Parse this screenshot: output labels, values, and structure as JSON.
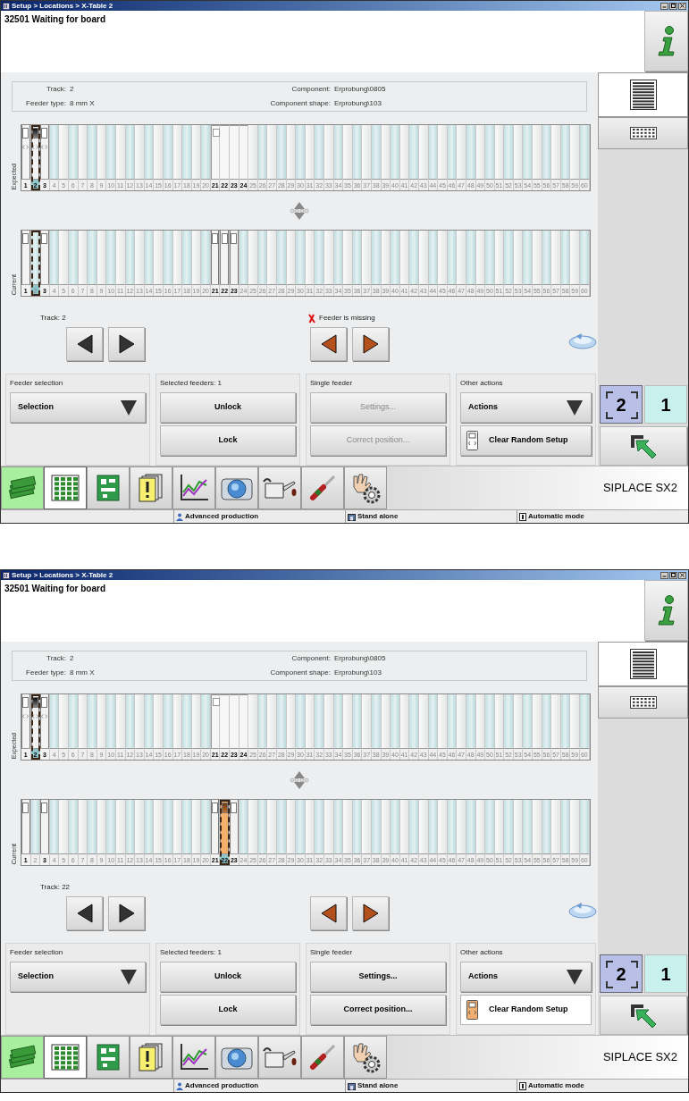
{
  "screens": [
    {
      "title": "Setup > Locations > X-Table 2",
      "message": "32501 Waiting for board",
      "info": [
        {
          "label": "Track:",
          "value": "2"
        },
        {
          "label": "Component:",
          "value": "Erprobung\\0805"
        },
        {
          "label": "Feeder type:",
          "value": "8 mm X"
        },
        {
          "label": "Component shape:",
          "value": "Erprobung\\103"
        }
      ],
      "view_tabs": [
        {
          "kind": "list",
          "selected": true
        },
        {
          "kind": "grid",
          "selected": false
        }
      ],
      "strips": [
        {
          "label": "Expected",
          "slots": [
            {
              "label": "1",
              "kind": "feeder",
              "selected": false
            },
            {
              "label": "2",
              "kind": "feeder",
              "selected": true
            },
            {
              "label": "3",
              "kind": "feeder",
              "selected": false
            },
            {
              "label": "4",
              "kind": "empty",
              "selected": false
            },
            {
              "label": "5",
              "kind": "empty",
              "selected": false
            },
            {
              "label": "6",
              "kind": "empty",
              "selected": false
            },
            {
              "label": "7",
              "kind": "empty",
              "selected": false
            },
            {
              "label": "8",
              "kind": "empty",
              "selected": false
            },
            {
              "label": "9",
              "kind": "empty",
              "selected": false
            },
            {
              "label": "10",
              "kind": "empty",
              "selected": false
            },
            {
              "label": "11",
              "kind": "empty",
              "selected": false
            },
            {
              "label": "12",
              "kind": "empty",
              "selected": false
            },
            {
              "label": "13",
              "kind": "empty",
              "selected": false
            },
            {
              "label": "14",
              "kind": "empty",
              "selected": false
            },
            {
              "label": "15",
              "kind": "empty",
              "selected": false
            },
            {
              "label": "16",
              "kind": "empty",
              "selected": false
            },
            {
              "label": "17",
              "kind": "empty",
              "selected": false
            },
            {
              "label": "18",
              "kind": "empty",
              "selected": false
            },
            {
              "label": "19",
              "kind": "empty",
              "selected": false
            },
            {
              "label": "20",
              "kind": "empty",
              "selected": false
            },
            {
              "label": "21",
              "kind": "wide",
              "selected": false
            },
            {
              "label": "22",
              "kind": "wide",
              "selected": false
            },
            {
              "label": "23",
              "kind": "wide",
              "selected": false
            },
            {
              "label": "24",
              "kind": "wide",
              "selected": false
            },
            {
              "label": "25",
              "kind": "empty",
              "selected": false
            },
            {
              "label": "26",
              "kind": "empty",
              "selected": false
            },
            {
              "label": "27",
              "kind": "empty",
              "selected": false
            },
            {
              "label": "28",
              "kind": "empty",
              "selected": false
            },
            {
              "label": "29",
              "kind": "empty",
              "selected": false
            },
            {
              "label": "30",
              "kind": "empty",
              "selected": false
            },
            {
              "label": "31",
              "kind": "empty",
              "selected": false
            },
            {
              "label": "32",
              "kind": "empty",
              "selected": false
            },
            {
              "label": "33",
              "kind": "empty",
              "selected": false
            },
            {
              "label": "34",
              "kind": "empty",
              "selected": false
            },
            {
              "label": "35",
              "kind": "empty",
              "selected": false
            },
            {
              "label": "36",
              "kind": "empty",
              "selected": false
            },
            {
              "label": "37",
              "kind": "empty",
              "selected": false
            },
            {
              "label": "38",
              "kind": "empty",
              "selected": false
            },
            {
              "label": "39",
              "kind": "empty",
              "selected": false
            },
            {
              "label": "40",
              "kind": "empty",
              "selected": false
            },
            {
              "label": "41",
              "kind": "empty",
              "selected": false
            },
            {
              "label": "42",
              "kind": "empty",
              "selected": false
            },
            {
              "label": "43",
              "kind": "empty",
              "selected": false
            },
            {
              "label": "44",
              "kind": "empty",
              "selected": false
            },
            {
              "label": "45",
              "kind": "empty",
              "selected": false
            },
            {
              "label": "46",
              "kind": "empty",
              "selected": false
            },
            {
              "label": "47",
              "kind": "empty",
              "selected": false
            },
            {
              "label": "48",
              "kind": "empty",
              "selected": false
            },
            {
              "label": "49",
              "kind": "empty",
              "selected": false
            },
            {
              "label": "50",
              "kind": "empty",
              "selected": false
            },
            {
              "label": "51",
              "kind": "empty",
              "selected": false
            },
            {
              "label": "52",
              "kind": "empty",
              "selected": false
            },
            {
              "label": "53",
              "kind": "empty",
              "selected": false
            },
            {
              "label": "54",
              "kind": "empty",
              "selected": false
            },
            {
              "label": "55",
              "kind": "empty",
              "selected": false
            },
            {
              "label": "56",
              "kind": "empty",
              "selected": false
            },
            {
              "label": "57",
              "kind": "empty",
              "selected": false
            },
            {
              "label": "58",
              "kind": "empty",
              "selected": false
            },
            {
              "label": "59",
              "kind": "empty",
              "selected": false
            },
            {
              "label": "60",
              "kind": "empty",
              "selected": false
            }
          ]
        },
        {
          "label": "Current",
          "slots": [
            {
              "label": "1",
              "kind": "feeder",
              "selected": false
            },
            {
              "label": "2",
              "kind": "empty",
              "selected": true
            },
            {
              "label": "3",
              "kind": "feeder",
              "selected": false
            },
            {
              "label": "4",
              "kind": "empty",
              "selected": false
            },
            {
              "label": "5",
              "kind": "empty",
              "selected": false
            },
            {
              "label": "6",
              "kind": "empty",
              "selected": false
            },
            {
              "label": "7",
              "kind": "empty",
              "selected": false
            },
            {
              "label": "8",
              "kind": "empty",
              "selected": false
            },
            {
              "label": "9",
              "kind": "empty",
              "selected": false
            },
            {
              "label": "10",
              "kind": "empty",
              "selected": false
            },
            {
              "label": "11",
              "kind": "empty",
              "selected": false
            },
            {
              "label": "12",
              "kind": "empty",
              "selected": false
            },
            {
              "label": "13",
              "kind": "empty",
              "selected": false
            },
            {
              "label": "14",
              "kind": "empty",
              "selected": false
            },
            {
              "label": "15",
              "kind": "empty",
              "selected": false
            },
            {
              "label": "16",
              "kind": "empty",
              "selected": false
            },
            {
              "label": "17",
              "kind": "empty",
              "selected": false
            },
            {
              "label": "18",
              "kind": "empty",
              "selected": false
            },
            {
              "label": "19",
              "kind": "empty",
              "selected": false
            },
            {
              "label": "20",
              "kind": "empty",
              "selected": false
            },
            {
              "label": "21",
              "kind": "feeder",
              "selected": false
            },
            {
              "label": "22",
              "kind": "feeder",
              "selected": false
            },
            {
              "label": "23",
              "kind": "feeder",
              "selected": false
            },
            {
              "label": "24",
              "kind": "empty",
              "selected": false
            },
            {
              "label": "25",
              "kind": "empty",
              "selected": false
            },
            {
              "label": "26",
              "kind": "empty",
              "selected": false
            },
            {
              "label": "27",
              "kind": "empty",
              "selected": false
            },
            {
              "label": "28",
              "kind": "empty",
              "selected": false
            },
            {
              "label": "29",
              "kind": "empty",
              "selected": false
            },
            {
              "label": "30",
              "kind": "empty",
              "selected": false
            },
            {
              "label": "31",
              "kind": "empty",
              "selected": false
            },
            {
              "label": "32",
              "kind": "empty",
              "selected": false
            },
            {
              "label": "33",
              "kind": "empty",
              "selected": false
            },
            {
              "label": "34",
              "kind": "empty",
              "selected": false
            },
            {
              "label": "35",
              "kind": "empty",
              "selected": false
            },
            {
              "label": "36",
              "kind": "empty",
              "selected": false
            },
            {
              "label": "37",
              "kind": "empty",
              "selected": false
            },
            {
              "label": "38",
              "kind": "empty",
              "selected": false
            },
            {
              "label": "39",
              "kind": "empty",
              "selected": false
            },
            {
              "label": "40",
              "kind": "empty",
              "selected": false
            },
            {
              "label": "41",
              "kind": "empty",
              "selected": false
            },
            {
              "label": "42",
              "kind": "empty",
              "selected": false
            },
            {
              "label": "43",
              "kind": "empty",
              "selected": false
            },
            {
              "label": "44",
              "kind": "empty",
              "selected": false
            },
            {
              "label": "45",
              "kind": "empty",
              "selected": false
            },
            {
              "label": "46",
              "kind": "empty",
              "selected": false
            },
            {
              "label": "47",
              "kind": "empty",
              "selected": false
            },
            {
              "label": "48",
              "kind": "empty",
              "selected": false
            },
            {
              "label": "49",
              "kind": "empty",
              "selected": false
            },
            {
              "label": "50",
              "kind": "empty",
              "selected": false
            },
            {
              "label": "51",
              "kind": "empty",
              "selected": false
            },
            {
              "label": "52",
              "kind": "empty",
              "selected": false
            },
            {
              "label": "53",
              "kind": "empty",
              "selected": false
            },
            {
              "label": "54",
              "kind": "empty",
              "selected": false
            },
            {
              "label": "55",
              "kind": "empty",
              "selected": false
            },
            {
              "label": "56",
              "kind": "empty",
              "selected": false
            },
            {
              "label": "57",
              "kind": "empty",
              "selected": false
            },
            {
              "label": "58",
              "kind": "empty",
              "selected": false
            },
            {
              "label": "59",
              "kind": "empty",
              "selected": false
            },
            {
              "label": "60",
              "kind": "empty",
              "selected": false
            }
          ]
        }
      ],
      "track_label": "Track: 2",
      "feeder_status": {
        "text": "Feeder is missing",
        "kind": "error"
      },
      "panels": [
        {
          "title": "Feeder selection",
          "controls": [
            {
              "kind": "dropdown",
              "label": "Selection"
            }
          ]
        },
        {
          "title": "Selected feeders: 1",
          "controls": [
            {
              "kind": "button",
              "label": "Unlock",
              "disabled": false
            },
            {
              "kind": "button",
              "label": "Lock",
              "disabled": false
            }
          ]
        },
        {
          "title": "Single feeder",
          "controls": [
            {
              "kind": "button",
              "label": "Settings...",
              "disabled": true
            },
            {
              "kind": "button",
              "label": "Correct position...",
              "disabled": true
            }
          ]
        },
        {
          "title": "Other actions",
          "controls": [
            {
              "kind": "dropdown",
              "label": "Actions"
            },
            {
              "kind": "icon_button",
              "label": "Clear Random Setup",
              "highlighted": false
            }
          ]
        }
      ],
      "layer_buttons": [
        {
          "label": "2",
          "selected": true
        },
        {
          "label": "1",
          "selected": false
        }
      ],
      "tools": [
        {
          "kind": "banknotes",
          "active": true,
          "selected": false
        },
        {
          "kind": "grid",
          "active": false,
          "selected": true
        },
        {
          "kind": "board",
          "active": false,
          "selected": false
        },
        {
          "kind": "documents",
          "active": false,
          "selected": false
        },
        {
          "kind": "chart",
          "active": false,
          "selected": false
        },
        {
          "kind": "camera",
          "active": false,
          "selected": false
        },
        {
          "kind": "oilcan",
          "active": false,
          "selected": false
        },
        {
          "kind": "screwdriver",
          "active": false,
          "selected": false
        },
        {
          "kind": "handgear",
          "active": false,
          "selected": false
        }
      ],
      "brand": "SIPLACE SX2",
      "status_bar": [
        {
          "kind": "user",
          "label": "Advanced production"
        },
        {
          "kind": "network",
          "label": "Stand alone"
        },
        {
          "kind": "mode",
          "label": "Automatic mode"
        }
      ]
    },
    {
      "title": "Setup > Locations > X-Table 2",
      "message": "32501 Waiting for board",
      "info": [
        {
          "label": "Track:",
          "value": "2"
        },
        {
          "label": "Component:",
          "value": "Erprobung\\0805"
        },
        {
          "label": "Feeder type:",
          "value": "8 mm X"
        },
        {
          "label": "Component shape:",
          "value": "Erprobung\\103"
        }
      ],
      "view_tabs": [
        {
          "kind": "list",
          "selected": true
        },
        {
          "kind": "grid",
          "selected": false
        }
      ],
      "strips": [
        {
          "label": "Expected",
          "slots": [
            {
              "label": "1",
              "kind": "feeder",
              "selected": false
            },
            {
              "label": "2",
              "kind": "feeder",
              "selected": true
            },
            {
              "label": "3",
              "kind": "feeder",
              "selected": false
            },
            {
              "label": "4",
              "kind": "empty",
              "selected": false
            },
            {
              "label": "5",
              "kind": "empty",
              "selected": false
            },
            {
              "label": "6",
              "kind": "empty",
              "selected": false
            },
            {
              "label": "7",
              "kind": "empty",
              "selected": false
            },
            {
              "label": "8",
              "kind": "empty",
              "selected": false
            },
            {
              "label": "9",
              "kind": "empty",
              "selected": false
            },
            {
              "label": "10",
              "kind": "empty",
              "selected": false
            },
            {
              "label": "11",
              "kind": "empty",
              "selected": false
            },
            {
              "label": "12",
              "kind": "empty",
              "selected": false
            },
            {
              "label": "13",
              "kind": "empty",
              "selected": false
            },
            {
              "label": "14",
              "kind": "empty",
              "selected": false
            },
            {
              "label": "15",
              "kind": "empty",
              "selected": false
            },
            {
              "label": "16",
              "kind": "empty",
              "selected": false
            },
            {
              "label": "17",
              "kind": "empty",
              "selected": false
            },
            {
              "label": "18",
              "kind": "empty",
              "selected": false
            },
            {
              "label": "19",
              "kind": "empty",
              "selected": false
            },
            {
              "label": "20",
              "kind": "empty",
              "selected": false
            },
            {
              "label": "21",
              "kind": "wide",
              "selected": false
            },
            {
              "label": "22",
              "kind": "wide",
              "selected": false
            },
            {
              "label": "23",
              "kind": "wide",
              "selected": false
            },
            {
              "label": "24",
              "kind": "wide",
              "selected": false
            },
            {
              "label": "25",
              "kind": "empty",
              "selected": false
            },
            {
              "label": "26",
              "kind": "empty",
              "selected": false
            },
            {
              "label": "27",
              "kind": "empty",
              "selected": false
            },
            {
              "label": "28",
              "kind": "empty",
              "selected": false
            },
            {
              "label": "29",
              "kind": "empty",
              "selected": false
            },
            {
              "label": "30",
              "kind": "empty",
              "selected": false
            },
            {
              "label": "31",
              "kind": "empty",
              "selected": false
            },
            {
              "label": "32",
              "kind": "empty",
              "selected": false
            },
            {
              "label": "33",
              "kind": "empty",
              "selected": false
            },
            {
              "label": "34",
              "kind": "empty",
              "selected": false
            },
            {
              "label": "35",
              "kind": "empty",
              "selected": false
            },
            {
              "label": "36",
              "kind": "empty",
              "selected": false
            },
            {
              "label": "37",
              "kind": "empty",
              "selected": false
            },
            {
              "label": "38",
              "kind": "empty",
              "selected": false
            },
            {
              "label": "39",
              "kind": "empty",
              "selected": false
            },
            {
              "label": "40",
              "kind": "empty",
              "selected": false
            },
            {
              "label": "41",
              "kind": "empty",
              "selected": false
            },
            {
              "label": "42",
              "kind": "empty",
              "selected": false
            },
            {
              "label": "43",
              "kind": "empty",
              "selected": false
            },
            {
              "label": "44",
              "kind": "empty",
              "selected": false
            },
            {
              "label": "45",
              "kind": "empty",
              "selected": false
            },
            {
              "label": "46",
              "kind": "empty",
              "selected": false
            },
            {
              "label": "47",
              "kind": "empty",
              "selected": false
            },
            {
              "label": "48",
              "kind": "empty",
              "selected": false
            },
            {
              "label": "49",
              "kind": "empty",
              "selected": false
            },
            {
              "label": "50",
              "kind": "empty",
              "selected": false
            },
            {
              "label": "51",
              "kind": "empty",
              "selected": false
            },
            {
              "label": "52",
              "kind": "empty",
              "selected": false
            },
            {
              "label": "53",
              "kind": "empty",
              "selected": false
            },
            {
              "label": "54",
              "kind": "empty",
              "selected": false
            },
            {
              "label": "55",
              "kind": "empty",
              "selected": false
            },
            {
              "label": "56",
              "kind": "empty",
              "selected": false
            },
            {
              "label": "57",
              "kind": "empty",
              "selected": false
            },
            {
              "label": "58",
              "kind": "empty",
              "selected": false
            },
            {
              "label": "59",
              "kind": "empty",
              "selected": false
            },
            {
              "label": "60",
              "kind": "empty",
              "selected": false
            }
          ]
        },
        {
          "label": "Current",
          "slots": [
            {
              "label": "1",
              "kind": "feeder",
              "selected": false
            },
            {
              "label": "2",
              "kind": "empty",
              "selected": false
            },
            {
              "label": "3",
              "kind": "feeder",
              "selected": false
            },
            {
              "label": "4",
              "kind": "empty",
              "selected": false
            },
            {
              "label": "5",
              "kind": "empty",
              "selected": false
            },
            {
              "label": "6",
              "kind": "empty",
              "selected": false
            },
            {
              "label": "7",
              "kind": "empty",
              "selected": false
            },
            {
              "label": "8",
              "kind": "empty",
              "selected": false
            },
            {
              "label": "9",
              "kind": "empty",
              "selected": false
            },
            {
              "label": "10",
              "kind": "empty",
              "selected": false
            },
            {
              "label": "11",
              "kind": "empty",
              "selected": false
            },
            {
              "label": "12",
              "kind": "empty",
              "selected": false
            },
            {
              "label": "13",
              "kind": "empty",
              "selected": false
            },
            {
              "label": "14",
              "kind": "empty",
              "selected": false
            },
            {
              "label": "15",
              "kind": "empty",
              "selected": false
            },
            {
              "label": "16",
              "kind": "empty",
              "selected": false
            },
            {
              "label": "17",
              "kind": "empty",
              "selected": false
            },
            {
              "label": "18",
              "kind": "empty",
              "selected": false
            },
            {
              "label": "19",
              "kind": "empty",
              "selected": false
            },
            {
              "label": "20",
              "kind": "empty",
              "selected": false
            },
            {
              "label": "21",
              "kind": "feeder",
              "selected": false
            },
            {
              "label": "22",
              "kind": "feeder",
              "selected": true
            },
            {
              "label": "23",
              "kind": "feeder",
              "selected": false
            },
            {
              "label": "24",
              "kind": "empty",
              "selected": false
            },
            {
              "label": "25",
              "kind": "empty",
              "selected": false
            },
            {
              "label": "26",
              "kind": "empty",
              "selected": false
            },
            {
              "label": "27",
              "kind": "empty",
              "selected": false
            },
            {
              "label": "28",
              "kind": "empty",
              "selected": false
            },
            {
              "label": "29",
              "kind": "empty",
              "selected": false
            },
            {
              "label": "30",
              "kind": "empty",
              "selected": false
            },
            {
              "label": "31",
              "kind": "empty",
              "selected": false
            },
            {
              "label": "32",
              "kind": "empty",
              "selected": false
            },
            {
              "label": "33",
              "kind": "empty",
              "selected": false
            },
            {
              "label": "34",
              "kind": "empty",
              "selected": false
            },
            {
              "label": "35",
              "kind": "empty",
              "selected": false
            },
            {
              "label": "36",
              "kind": "empty",
              "selected": false
            },
            {
              "label": "37",
              "kind": "empty",
              "selected": false
            },
            {
              "label": "38",
              "kind": "empty",
              "selected": false
            },
            {
              "label": "39",
              "kind": "empty",
              "selected": false
            },
            {
              "label": "40",
              "kind": "empty",
              "selected": false
            },
            {
              "label": "41",
              "kind": "empty",
              "selected": false
            },
            {
              "label": "42",
              "kind": "empty",
              "selected": false
            },
            {
              "label": "43",
              "kind": "empty",
              "selected": false
            },
            {
              "label": "44",
              "kind": "empty",
              "selected": false
            },
            {
              "label": "45",
              "kind": "empty",
              "selected": false
            },
            {
              "label": "46",
              "kind": "empty",
              "selected": false
            },
            {
              "label": "47",
              "kind": "empty",
              "selected": false
            },
            {
              "label": "48",
              "kind": "empty",
              "selected": false
            },
            {
              "label": "49",
              "kind": "empty",
              "selected": false
            },
            {
              "label": "50",
              "kind": "empty",
              "selected": false
            },
            {
              "label": "51",
              "kind": "empty",
              "selected": false
            },
            {
              "label": "52",
              "kind": "empty",
              "selected": false
            },
            {
              "label": "53",
              "kind": "empty",
              "selected": false
            },
            {
              "label": "54",
              "kind": "empty",
              "selected": false
            },
            {
              "label": "55",
              "kind": "empty",
              "selected": false
            },
            {
              "label": "56",
              "kind": "empty",
              "selected": false
            },
            {
              "label": "57",
              "kind": "empty",
              "selected": false
            },
            {
              "label": "58",
              "kind": "empty",
              "selected": false
            },
            {
              "label": "59",
              "kind": "empty",
              "selected": false
            },
            {
              "label": "60",
              "kind": "empty",
              "selected": false
            }
          ]
        }
      ],
      "track_label": "Track: 22",
      "panels": [
        {
          "title": "Feeder selection",
          "controls": [
            {
              "kind": "dropdown",
              "label": "Selection"
            }
          ]
        },
        {
          "title": "Selected feeders: 1",
          "controls": [
            {
              "kind": "button",
              "label": "Unlock",
              "disabled": false
            },
            {
              "kind": "button",
              "label": "Lock",
              "disabled": false
            }
          ]
        },
        {
          "title": "Single feeder",
          "controls": [
            {
              "kind": "button",
              "label": "Settings...",
              "disabled": false
            },
            {
              "kind": "button",
              "label": "Correct position...",
              "disabled": false
            }
          ]
        },
        {
          "title": "Other actions",
          "controls": [
            {
              "kind": "dropdown",
              "label": "Actions"
            },
            {
              "kind": "icon_button",
              "label": "Clear Random Setup",
              "highlighted": true
            }
          ]
        }
      ],
      "layer_buttons": [
        {
          "label": "2",
          "selected": true
        },
        {
          "label": "1",
          "selected": false
        }
      ],
      "tools": [
        {
          "kind": "banknotes",
          "active": true,
          "selected": false
        },
        {
          "kind": "grid",
          "active": false,
          "selected": true
        },
        {
          "kind": "board",
          "active": false,
          "selected": false
        },
        {
          "kind": "documents",
          "active": false,
          "selected": false
        },
        {
          "kind": "chart",
          "active": false,
          "selected": false
        },
        {
          "kind": "camera",
          "active": false,
          "selected": false
        },
        {
          "kind": "oilcan",
          "active": false,
          "selected": false
        },
        {
          "kind": "screwdriver",
          "active": false,
          "selected": false
        },
        {
          "kind": "handgear",
          "active": false,
          "selected": false
        }
      ],
      "brand": "SIPLACE SX2",
      "status_bar": [
        {
          "kind": "user",
          "label": "Advanced production"
        },
        {
          "kind": "network",
          "label": "Stand alone"
        },
        {
          "kind": "mode",
          "label": "Automatic mode"
        }
      ]
    }
  ]
}
